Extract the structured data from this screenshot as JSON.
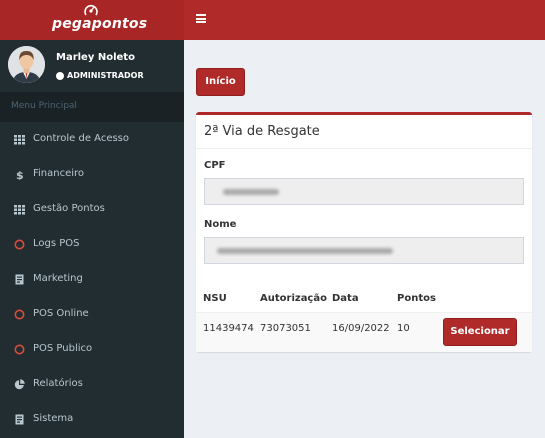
{
  "header": {
    "logo_text": "pegapontos"
  },
  "user": {
    "name": "Marley Noleto",
    "role": "ADMINISTRADOR"
  },
  "sidebar": {
    "section_title": "Menu Principal",
    "items": [
      {
        "label": "Controle de Acesso",
        "icon": "grid-icon"
      },
      {
        "label": "Financeiro",
        "icon": "dollar-icon"
      },
      {
        "label": "Gestão Pontos",
        "icon": "grid-icon"
      },
      {
        "label": "Logs POS",
        "icon": "circle-outline-icon"
      },
      {
        "label": "Marketing",
        "icon": "document-icon"
      },
      {
        "label": "POS Online",
        "icon": "circle-outline-icon"
      },
      {
        "label": "POS Publico",
        "icon": "circle-outline-icon"
      },
      {
        "label": "Relatórios",
        "icon": "pie-chart-icon"
      },
      {
        "label": "Sistema",
        "icon": "document-icon"
      }
    ]
  },
  "main": {
    "home_button": "Início",
    "box_title": "2ª Via de Resgate",
    "cpf_label": "CPF",
    "nome_label": "Nome",
    "table": {
      "columns": [
        "NSU",
        "Autorização",
        "Data",
        "Pontos"
      ],
      "rows": [
        {
          "nsu": "11439474",
          "autorizacao": "73073051",
          "data": "16/09/2022",
          "pontos": "10",
          "action": "Selecionar"
        }
      ]
    }
  },
  "colors": {
    "brand": "#b02a2a",
    "sidebar": "#222d32",
    "sidebar_text": "#b8c7ce",
    "content_bg": "#ecf0f5"
  }
}
